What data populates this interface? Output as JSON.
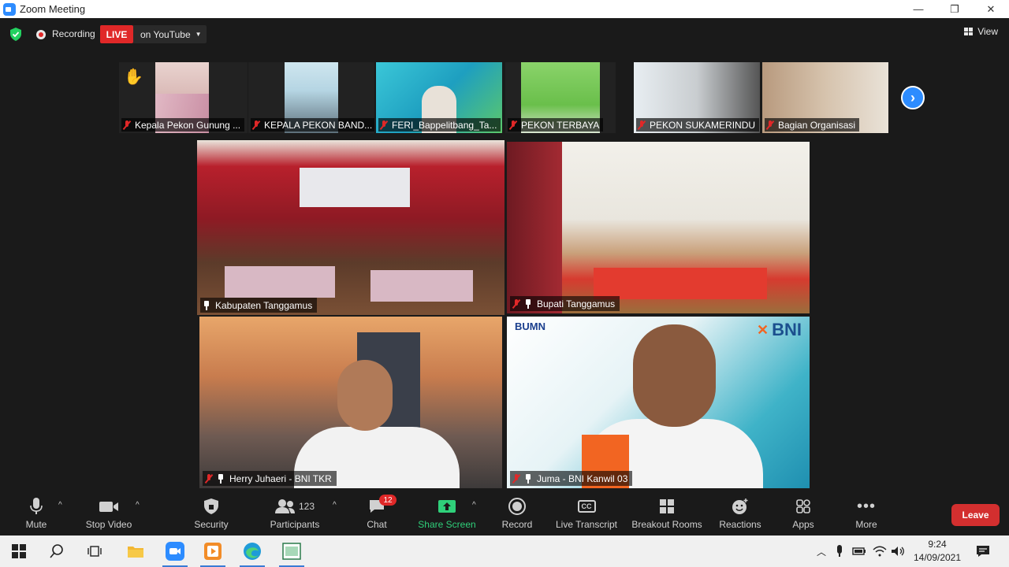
{
  "window": {
    "title": "Zoom Meeting",
    "minimize": "—",
    "restore": "❐",
    "close": "✕"
  },
  "topbar": {
    "recording_label": "Recording",
    "live_label": "LIVE",
    "stream_target": "on YouTube",
    "view_label": "View"
  },
  "strip": {
    "participants": [
      {
        "name": "Kepala Pekon Gunung ..."
      },
      {
        "name": "KEPALA PEKON BAND..."
      },
      {
        "name": "FERI_Bappelitbang_Ta..."
      },
      {
        "name": "PEKON TERBAYA"
      },
      {
        "name": "PEKON SUKAMERINDU"
      },
      {
        "name": "Bagian Organisasi"
      }
    ]
  },
  "tiles": [
    {
      "name": "Kabupaten Tanggamus"
    },
    {
      "name": "Bupati Tanggamus"
    },
    {
      "name": "Herry Juhaeri - BNI TKR"
    },
    {
      "name": "Juma - BNI Kanwil 03"
    }
  ],
  "tile_text": {
    "bumn": "BUMN",
    "bni": "BNI"
  },
  "toolbar": {
    "mute": "Mute",
    "stop_video": "Stop Video",
    "security": "Security",
    "participants": "Participants",
    "participants_count": "123",
    "chat": "Chat",
    "chat_badge": "12",
    "share_screen": "Share Screen",
    "record": "Record",
    "live_transcript": "Live Transcript",
    "breakout_rooms": "Breakout Rooms",
    "reactions": "Reactions",
    "apps": "Apps",
    "more": "More",
    "leave": "Leave"
  },
  "taskbar": {
    "time": "9:24",
    "date": "14/09/2021"
  },
  "colors": {
    "accent": "#2d8cff",
    "live_red": "#e02828",
    "active_speaker": "#b8e33a",
    "share_green": "#2fd07a"
  }
}
